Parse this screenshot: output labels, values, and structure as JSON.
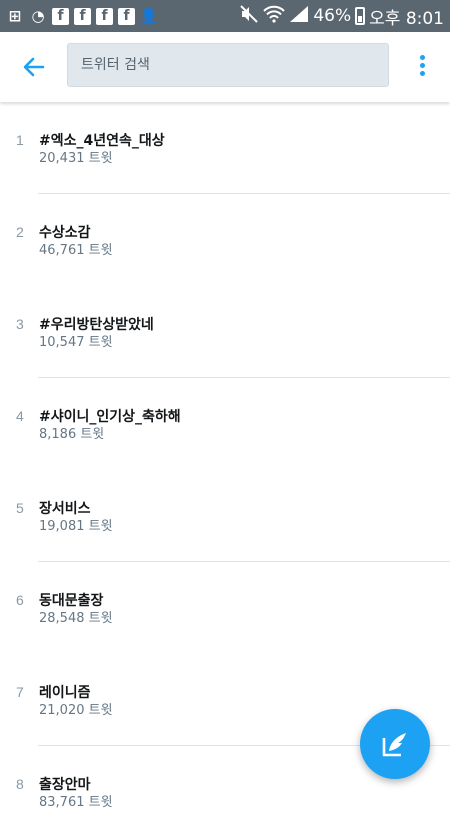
{
  "status_bar": {
    "battery": "46%",
    "time": "오후 8:01",
    "icons": [
      "add-box-icon",
      "record-icon",
      "facebook-icon",
      "facebook-icon",
      "facebook-icon",
      "facebook-icon",
      "add-person-icon",
      "mute-icon",
      "wifi-icon",
      "signal-icon",
      "battery-charging-icon"
    ]
  },
  "header": {
    "back_icon": "arrow-left-icon",
    "search_placeholder": "트위터 검색",
    "menu_icon": "more-vertical-icon"
  },
  "trends": [
    {
      "rank": "1",
      "name": "#엑소_4년연속_대상",
      "count": "20,431 트윗"
    },
    {
      "rank": "2",
      "name": "수상소감",
      "count": "46,761 트윗"
    },
    {
      "rank": "3",
      "name": "#우리방탄상받았네",
      "count": "10,547 트윗"
    },
    {
      "rank": "4",
      "name": "#샤이니_인기상_축하해",
      "count": "8,186 트윗"
    },
    {
      "rank": "5",
      "name": "장서비스",
      "count": "19,081 트윗"
    },
    {
      "rank": "6",
      "name": "동대문출장",
      "count": "28,548 트윗"
    },
    {
      "rank": "7",
      "name": "레이니즘",
      "count": "21,020 트윗"
    },
    {
      "rank": "8",
      "name": "출장안마",
      "count": "83,761 트윗"
    }
  ],
  "fab": {
    "icon": "compose-tweet-icon"
  },
  "colors": {
    "accent": "#1da1f2",
    "status_bar": "#5b6770",
    "divider": "#d5e7ef"
  }
}
